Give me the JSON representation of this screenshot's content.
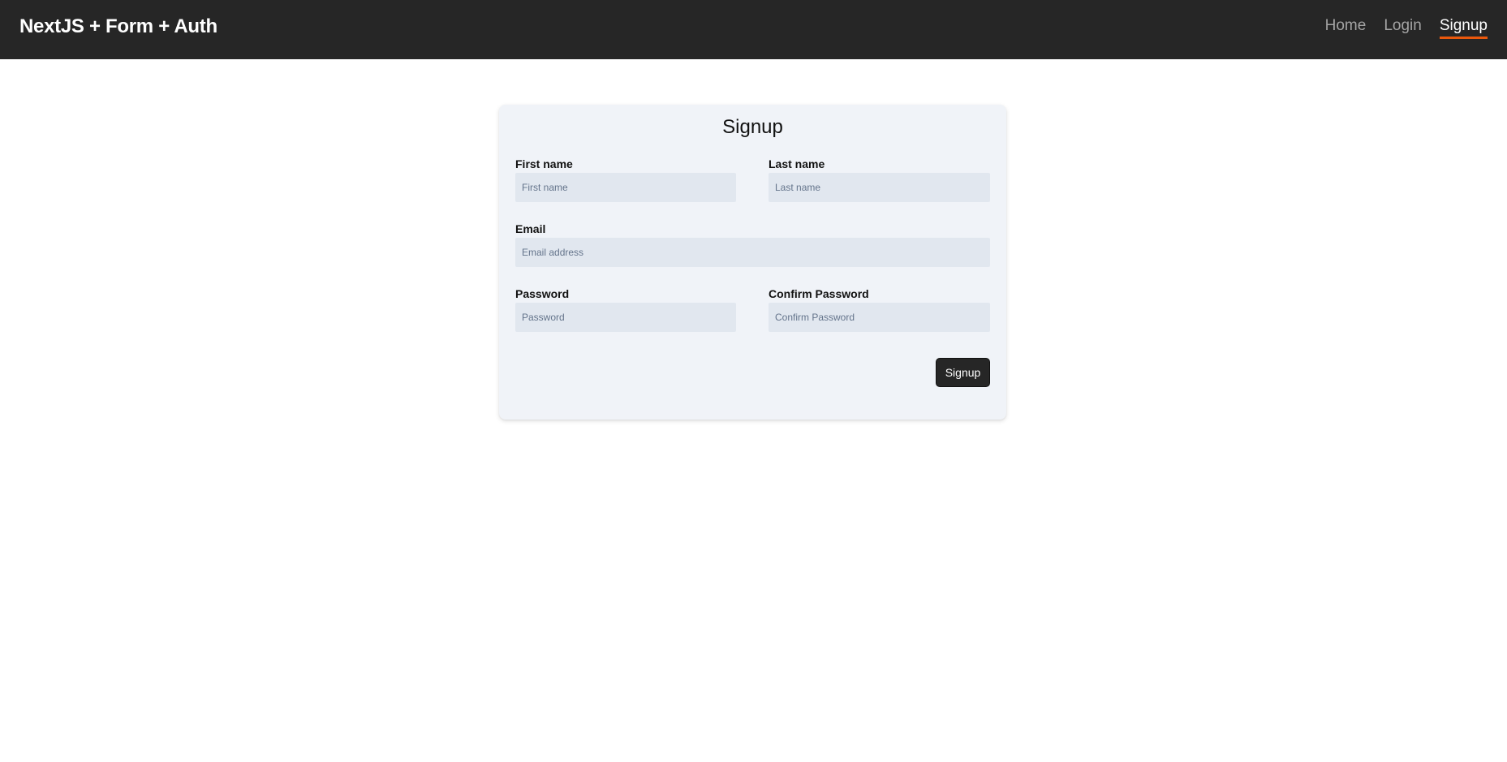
{
  "navbar": {
    "brand": "NextJS + Form + Auth",
    "links": [
      {
        "label": "Home",
        "active": false
      },
      {
        "label": "Login",
        "active": false
      },
      {
        "label": "Signup",
        "active": true
      }
    ],
    "accent_color": "#ea580c",
    "background_color": "#262626"
  },
  "form": {
    "title": "Signup",
    "fields": {
      "first_name": {
        "label": "First name",
        "placeholder": "First name",
        "value": ""
      },
      "last_name": {
        "label": "Last name",
        "placeholder": "Last name",
        "value": ""
      },
      "email": {
        "label": "Email",
        "placeholder": "Email address",
        "value": ""
      },
      "password": {
        "label": "Password",
        "placeholder": "Password",
        "value": ""
      },
      "confirm_password": {
        "label": "Confirm Password",
        "placeholder": "Confirm Password",
        "value": ""
      }
    },
    "submit_label": "Signup"
  }
}
